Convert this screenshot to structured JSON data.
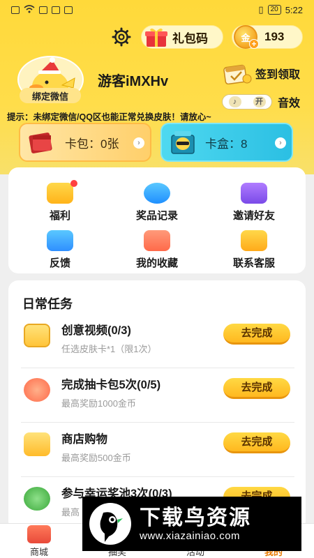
{
  "status_bar": {
    "time": "5:22",
    "battery": "20"
  },
  "header": {
    "gift_code_label": "礼包码",
    "coin_count": "193",
    "coin_glyph": "金"
  },
  "profile": {
    "bind_label": "绑定微信",
    "username": "游客iMXHv",
    "checkin_label": "签到领取",
    "sound_label": "音效",
    "toggle_left": "♪",
    "toggle_right": "开"
  },
  "notice": "提示：未绑定微信/QQ区也能正常兑换皮肤！请放心~",
  "cards": [
    {
      "label": "卡包：0张"
    },
    {
      "label": "卡盒：8"
    }
  ],
  "grid": [
    {
      "label": "福利"
    },
    {
      "label": "奖品记录"
    },
    {
      "label": "邀请好友"
    },
    {
      "label": "反馈"
    },
    {
      "label": "我的收藏"
    },
    {
      "label": "联系客服"
    }
  ],
  "tasks": {
    "title": "日常任务",
    "items": [
      {
        "title": "创意视频(0/3)",
        "subtitle": "任选皮肤卡*1（限1次）",
        "button": "去完成"
      },
      {
        "title": "完成抽卡包5次(0/5)",
        "subtitle": "最高奖励1000金币",
        "button": "去完成"
      },
      {
        "title": "商店购物",
        "subtitle": "最高奖励500金币",
        "button": "去完成"
      },
      {
        "title": "参与幸运奖池3次(0/3)",
        "subtitle": "最高",
        "button": "去完成"
      }
    ]
  },
  "nav": [
    {
      "label": "商城"
    },
    {
      "label": "抽奖"
    },
    {
      "label": "活动"
    },
    {
      "label": "我的"
    }
  ],
  "watermark": {
    "title": "下载鸟资源",
    "url": "www.xiazainiao.com"
  },
  "colors": {
    "accent_yellow": "#ffd93a",
    "button_orange": "#ffb81f",
    "active_nav": "#e87a00"
  }
}
